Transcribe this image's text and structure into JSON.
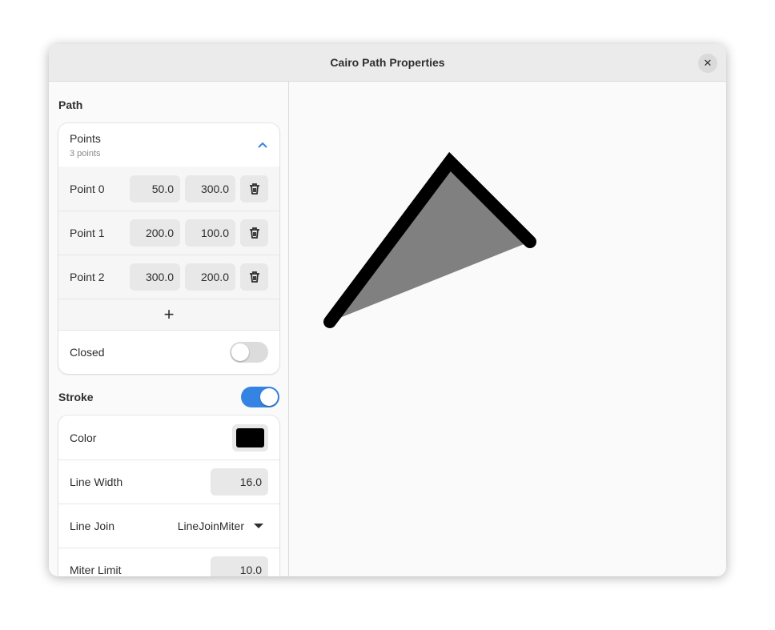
{
  "window": {
    "title": "Cairo Path Properties"
  },
  "path": {
    "heading": "Path",
    "points_title": "Points",
    "points_subtitle": "3 points",
    "points": [
      {
        "label": "Point 0",
        "x": "50.0",
        "y": "300.0"
      },
      {
        "label": "Point 1",
        "x": "200.0",
        "y": "100.0"
      },
      {
        "label": "Point 2",
        "x": "300.0",
        "y": "200.0"
      }
    ],
    "add_label": "+",
    "closed_label": "Closed",
    "closed": false
  },
  "stroke": {
    "heading": "Stroke",
    "enabled": true,
    "color_label": "Color",
    "color": "#000000",
    "line_width_label": "Line Width",
    "line_width": "16.0",
    "line_join_label": "Line Join",
    "line_join": "LineJoinMiter",
    "miter_limit_label": "Miter Limit",
    "miter_limit": "10.0"
  },
  "canvas": {
    "fill_color": "#808080",
    "stroke_color": "#000000",
    "accent": "#3584e4"
  }
}
